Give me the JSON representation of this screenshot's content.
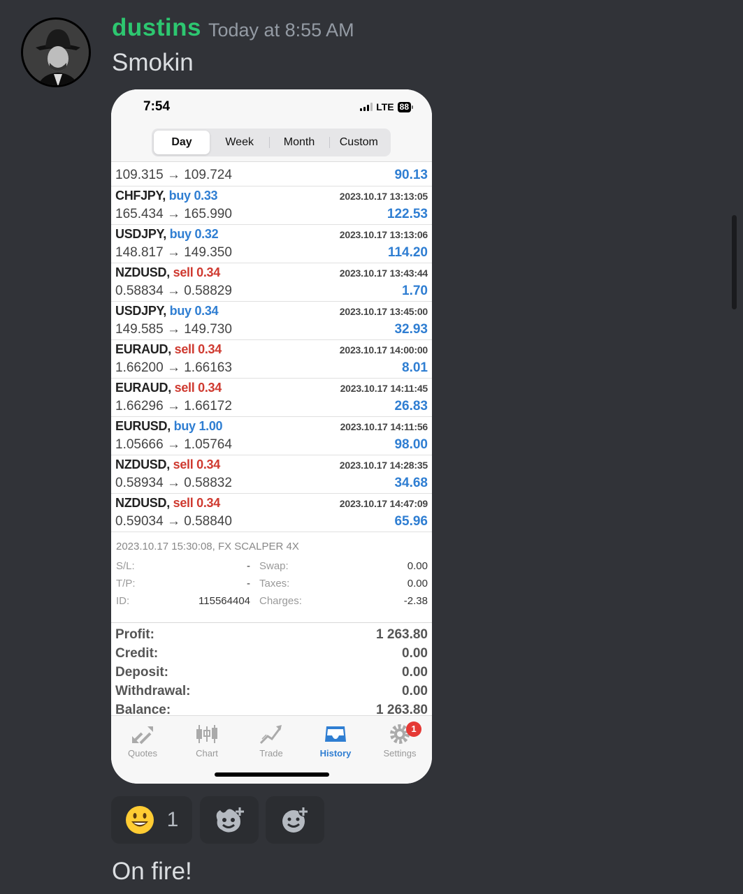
{
  "message": {
    "username": "dustins",
    "timestamp": "Today at 8:55 AM",
    "text": "Smokin",
    "followup_text": "On fire!"
  },
  "phone": {
    "status": {
      "time": "7:54",
      "network": "LTE",
      "battery": "88"
    },
    "segments": [
      "Day",
      "Week",
      "Month",
      "Custom"
    ],
    "active_segment": "Day",
    "partial_row": {
      "prices": "109.315 → 109.724",
      "profit": "90.13"
    },
    "trades": [
      {
        "symbol": "CHFJPY,",
        "direction": "buy",
        "volume": "0.33",
        "time": "2023.10.17 13:13:05",
        "prices": "165.434 → 165.990",
        "profit": "122.53"
      },
      {
        "symbol": "USDJPY,",
        "direction": "buy",
        "volume": "0.32",
        "time": "2023.10.17 13:13:06",
        "prices": "148.817 → 149.350",
        "profit": "114.20"
      },
      {
        "symbol": "NZDUSD,",
        "direction": "sell",
        "volume": "0.34",
        "time": "2023.10.17 13:43:44",
        "prices": "0.58834 → 0.58829",
        "profit": "1.70"
      },
      {
        "symbol": "USDJPY,",
        "direction": "buy",
        "volume": "0.34",
        "time": "2023.10.17 13:45:00",
        "prices": "149.585 → 149.730",
        "profit": "32.93"
      },
      {
        "symbol": "EURAUD,",
        "direction": "sell",
        "volume": "0.34",
        "time": "2023.10.17 14:00:00",
        "prices": "1.66200 → 1.66163",
        "profit": "8.01"
      },
      {
        "symbol": "EURAUD,",
        "direction": "sell",
        "volume": "0.34",
        "time": "2023.10.17 14:11:45",
        "prices": "1.66296 → 1.66172",
        "profit": "26.83"
      },
      {
        "symbol": "EURUSD,",
        "direction": "buy",
        "volume": "1.00",
        "time": "2023.10.17 14:11:56",
        "prices": "1.05666 → 1.05764",
        "profit": "98.00"
      },
      {
        "symbol": "NZDUSD,",
        "direction": "sell",
        "volume": "0.34",
        "time": "2023.10.17 14:28:35",
        "prices": "0.58934 → 0.58832",
        "profit": "34.68"
      },
      {
        "symbol": "NZDUSD,",
        "direction": "sell",
        "volume": "0.34",
        "time": "2023.10.17 14:47:09",
        "prices": "0.59034 → 0.58840",
        "profit": "65.96"
      }
    ],
    "detail": {
      "header": "2023.10.17 15:30:08, FX SCALPER 4X",
      "sl_label": "S/L:",
      "sl_value": "-",
      "tp_label": "T/P:",
      "tp_value": "-",
      "id_label": "ID:",
      "id_value": "115564404",
      "swap_label": "Swap:",
      "swap_value": "0.00",
      "taxes_label": "Taxes:",
      "taxes_value": "0.00",
      "charges_label": "Charges:",
      "charges_value": "-2.38"
    },
    "summary": [
      {
        "label": "Profit:",
        "value": "1 263.80"
      },
      {
        "label": "Credit:",
        "value": "0.00"
      },
      {
        "label": "Deposit:",
        "value": "0.00"
      },
      {
        "label": "Withdrawal:",
        "value": "0.00"
      },
      {
        "label": "Balance:",
        "value": "1 263.80"
      }
    ],
    "tabs": {
      "quotes": "Quotes",
      "chart": "Chart",
      "trade": "Trade",
      "history": "History",
      "settings": "Settings",
      "settings_badge": "1"
    }
  },
  "reactions": [
    {
      "emoji": "smiley-face",
      "count": "1"
    },
    {
      "emoji": "add-super-reaction-icon"
    },
    {
      "emoji": "add-reaction-icon"
    }
  ],
  "colors": {
    "background": "#313338",
    "username": "#2dc770",
    "buy": "#2f7ed2",
    "sell": "#cf3a30",
    "active_tab": "#2f7ed2"
  }
}
